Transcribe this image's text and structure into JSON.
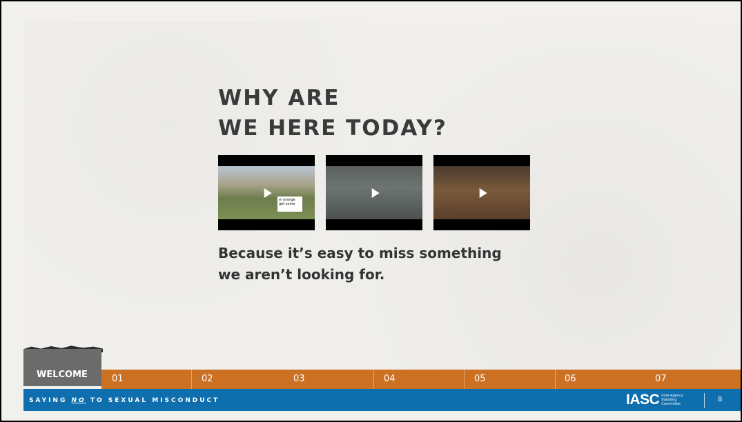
{
  "slide": {
    "title_line1": "WHY ARE",
    "title_line2": "WE HERE TODAY?",
    "caption_line1": "Because it’s easy to miss something",
    "caption_line2": "we aren’t looking for.",
    "video_sign_text": "in orange get some"
  },
  "nav": {
    "welcome": "WELCOME",
    "items": [
      "01",
      "02",
      "03",
      "04",
      "05",
      "06",
      "07"
    ]
  },
  "footer": {
    "text_before": "SAYING ",
    "text_emph": "NO",
    "text_after": " TO SEXUAL MISCONDUCT",
    "logo": "IASC",
    "logo_sub1": "Inter-Agency",
    "logo_sub2": "Standing",
    "logo_sub3": "Committee",
    "page_number": "8"
  },
  "colors": {
    "nav_orange": "#cc7023",
    "footer_blue": "#0f6fae",
    "welcome_gray": "#6b6b6b",
    "title_text": "#3a3a3a"
  },
  "icons": [
    "play-icon"
  ]
}
